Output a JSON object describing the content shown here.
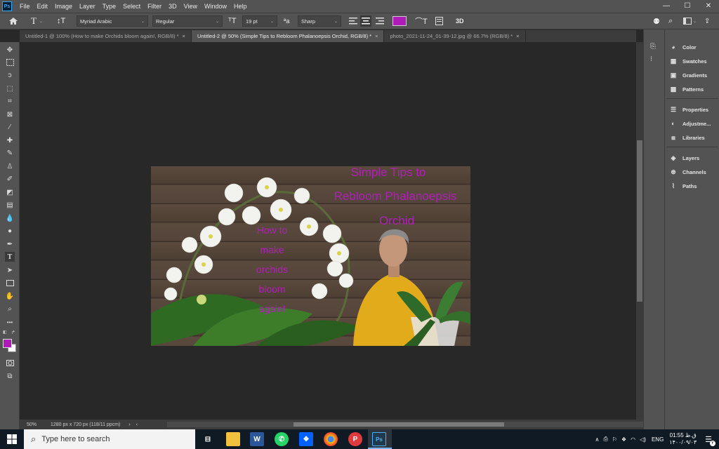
{
  "app": {
    "logo": "Ps"
  },
  "menu": [
    "File",
    "Edit",
    "Image",
    "Layer",
    "Type",
    "Select",
    "Filter",
    "3D",
    "View",
    "Window",
    "Help"
  ],
  "window_controls": {
    "minimize": "—",
    "maximize": "☐",
    "close": "✕"
  },
  "options": {
    "font_family": "Myriad Arabic",
    "font_style": "Regular",
    "font_size": "19 pt",
    "antialias": "Sharp",
    "color_hex": "#b01ab8",
    "three_d": "3D"
  },
  "tabs": [
    {
      "label": "Untitled-1 @ 100% (How to make Orchids bloom again!, RGB/8) *",
      "close": "×"
    },
    {
      "label": "Untitled-2 @ 50% (Simple Tips to Rebloom Phalanoepsis Orchid, RGB/8) *",
      "close": "×",
      "active": true
    },
    {
      "label": "photo_2021-11-24_01-39-12.jpg @ 66.7% (RGB/8) *",
      "close": "×"
    }
  ],
  "document": {
    "title_line1": "Simple Tips to",
    "title_line2": "Rebloom Phalanoepsis",
    "title_line3": "Orchid",
    "left_text": [
      "How to",
      "make",
      "orchids",
      "bloom",
      "again!"
    ]
  },
  "status": {
    "zoom": "50%",
    "doc_info": "1280 px x 720 px (118/11 ppcm)",
    "arrow": "›",
    "left_arrow": "‹"
  },
  "panels": {
    "group1": [
      "Color",
      "Swatches",
      "Gradients",
      "Patterns"
    ],
    "group2": [
      "Properties",
      "Adjustme...",
      "Libraries"
    ],
    "group3": [
      "Layers",
      "Channels",
      "Paths"
    ]
  },
  "taskbar": {
    "search_placeholder": "Type here to search",
    "lang": "ENG",
    "time": "01:55 ق.ظ",
    "date": "۱۴۰۰/۰۹/۰۳",
    "badge": "۲"
  },
  "colors": {
    "foreground": "#b01ab8",
    "background": "#ffffff",
    "text_color": "#b020b8"
  }
}
